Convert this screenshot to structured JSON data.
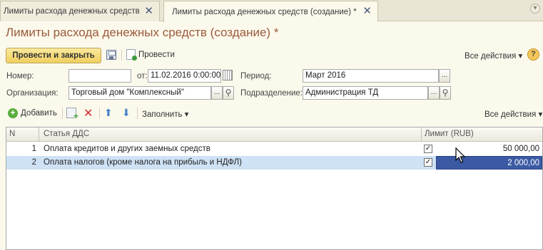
{
  "tabs": [
    {
      "label": "Лимиты расхода денежных средств",
      "close": "✕"
    },
    {
      "label": "Лимиты расхода денежных средств (создание) *",
      "close": "✕"
    }
  ],
  "title": "Лимиты расхода денежных средств (создание) *",
  "toolbar": {
    "post_and_close": "Провести и закрыть",
    "post": "Провести",
    "all_actions": "Все действия",
    "help": "?"
  },
  "form": {
    "number_label": "Номер:",
    "number_value": "",
    "date_label": "от:",
    "date_value": "11.02.2016  0:00:00",
    "period_label": "Период:",
    "period_value": "Март 2016",
    "org_label": "Организация:",
    "org_value": "Торговый дом \"Комплексный\"",
    "dept_label": "Подразделение:",
    "dept_value": "Администрация ТД"
  },
  "table_toolbar": {
    "add": "Добавить",
    "fill": "Заполнить",
    "all_actions": "Все действия"
  },
  "table": {
    "columns": [
      "N",
      "Статья ДДС",
      "Лимит (RUB)"
    ],
    "rows": [
      {
        "n": "1",
        "article": "Оплата кредитов и других заемных средств",
        "checked": true,
        "limit": "50 000,00"
      },
      {
        "n": "2",
        "article": "Оплата налогов (кроме налога на прибыль и НДФЛ)",
        "checked": true,
        "limit": "2 000,00"
      }
    ],
    "selected_row": 2
  },
  "colors": {
    "background": "#fbf9ec",
    "title": "#9c5a3c",
    "primary_button": "#f0cf5e",
    "selected_row": "#cfe2f5",
    "selected_cell": "#3b5aa3"
  }
}
